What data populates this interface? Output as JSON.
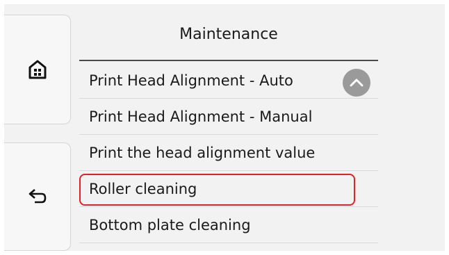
{
  "header": {
    "title": "Maintenance"
  },
  "nav": {
    "home_icon": "home-icon",
    "back_icon": "back-arrow-icon",
    "scroll_icon": "chevron-up-icon"
  },
  "menu": {
    "items": [
      {
        "label": "Print Head Alignment - Auto"
      },
      {
        "label": "Print Head Alignment - Manual"
      },
      {
        "label": "Print the head alignment value"
      },
      {
        "label": "Roller cleaning",
        "highlighted": true
      },
      {
        "label": "Bottom plate cleaning"
      }
    ]
  },
  "colors": {
    "highlight": "#e0202a",
    "panel_background": "#f2f2f2",
    "scroll_button": "#9a9a9a"
  }
}
